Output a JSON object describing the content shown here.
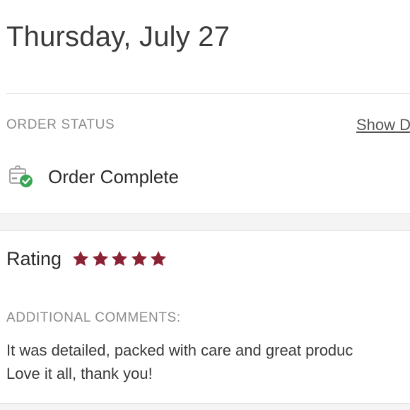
{
  "order": {
    "date_title": "Thursday, July 27",
    "status_section_label": "ORDER STATUS",
    "show_details_label": "Show D",
    "status_icon": "package-check-icon",
    "status_text": "Order Complete"
  },
  "review": {
    "rating_label": "Rating",
    "rating_value": 5,
    "rating_max": 5,
    "star_icon": "star-icon",
    "star_color": "#8a2234",
    "comments_label": "ADDITIONAL COMMENTS:",
    "comment_text": "It was detailed, packed with care and great produc\nLove it all, thank you!"
  },
  "colors": {
    "status_check_green": "#3aa655",
    "muted_label": "#8c8c8c"
  }
}
